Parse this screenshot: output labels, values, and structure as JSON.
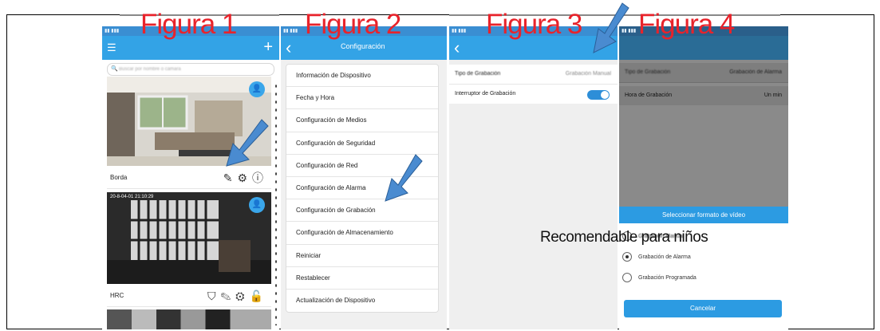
{
  "figures": [
    "Figura 1",
    "Figura 2",
    "Figura 3",
    "Figura 4"
  ],
  "panel1": {
    "search_placeholder": "Buscar por nombre o cámara",
    "cameras": [
      {
        "name": "Borda"
      },
      {
        "name": "HRC",
        "timestamp": "20-8-04-01  21:10:29"
      }
    ]
  },
  "panel2": {
    "title": "Configuración",
    "menu": [
      "Información de Dispositivo",
      "Fecha y Hora",
      "Configuración de Medios",
      "Configuración de Seguridad",
      "Configuración de Red",
      "Configuración de Alarma",
      "Configuración de Grabación",
      "Configuración de Almacenamiento",
      "Reiniciar",
      "Restablecer",
      "Actualización de Dispositivo"
    ]
  },
  "panel3": {
    "rows": [
      {
        "label": "Tipo de Grabación",
        "value": "Grabación Manual"
      },
      {
        "label": "Interruptor de Grabación"
      }
    ],
    "toggle_on": true
  },
  "panel4": {
    "rows": [
      {
        "label": "Tipo de Grabación",
        "value": "Grabación de Alarma"
      },
      {
        "label": "Hora de Grabación",
        "value": "Un min"
      }
    ],
    "sheet_title": "Seleccionar formato de vídeo",
    "options": [
      "Grabación Manual",
      "Grabación de Alarma",
      "Grabación Programada"
    ],
    "selected_index": 1,
    "cancel_label": "Cancelar"
  },
  "annotation": "Recomendable para niños",
  "colors": {
    "figure_label": "#e8232b",
    "app_blue": "#33a3e6",
    "arrow": "#4a8bd0"
  }
}
